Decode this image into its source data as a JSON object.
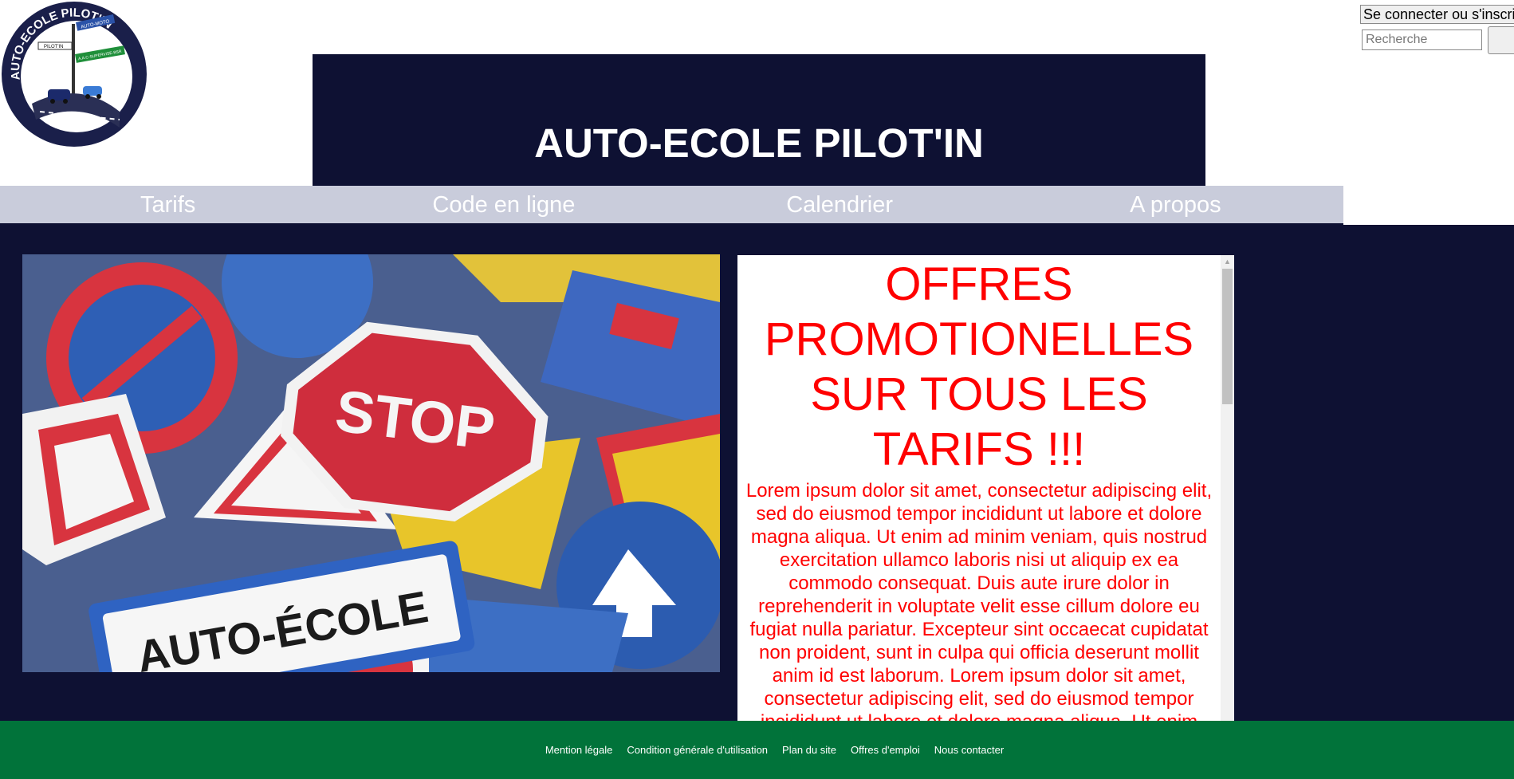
{
  "logo": {
    "text": "AUTO-ECOLE PILOT'IN",
    "sign1": "AUTO-MOTO",
    "sign2": "PILOT'IN",
    "sign3": "A.A.C-SUPERVISE-BSR"
  },
  "header": {
    "title": "AUTO-ECOLE PILOT'IN"
  },
  "account": {
    "login_label": "Se connecter ou s'inscrire",
    "search_placeholder": "Recherche"
  },
  "nav": {
    "items": [
      "Tarifs",
      "Code en ligne",
      "Calendrier",
      "A propos"
    ]
  },
  "hero": {
    "stop_text": "STOP",
    "sign_text": "AUTO-ÉCOLE"
  },
  "promo": {
    "title": "OFFRES PROMOTIONELLES SUR TOUS LES TARIFS !!!",
    "text": "Lorem ipsum dolor sit amet, consectetur adipiscing elit, sed do eiusmod tempor incididunt ut labore et dolore magna aliqua. Ut enim ad minim veniam, quis nostrud exercitation ullamco laboris nisi ut aliquip ex ea commodo consequat. Duis aute irure dolor in reprehenderit in voluptate velit esse cillum dolore eu fugiat nulla pariatur. Excepteur sint occaecat cupidatat non proident, sunt in culpa qui officia deserunt mollit anim id est laborum. Lorem ipsum dolor sit amet, consectetur adipiscing elit, sed do eiusmod tempor incididunt ut labore et dolore magna aliqua. Ut enim"
  },
  "footer": {
    "links": [
      "Mention légale",
      "Condition générale d'utilisation",
      "Plan du site",
      "Offres d'emploi",
      "Nous contacter"
    ]
  },
  "colors": {
    "navy": "#0e1133",
    "nav_bg": "#c9ccdb",
    "promo_red": "#ff0000",
    "footer_green": "#01733a"
  }
}
